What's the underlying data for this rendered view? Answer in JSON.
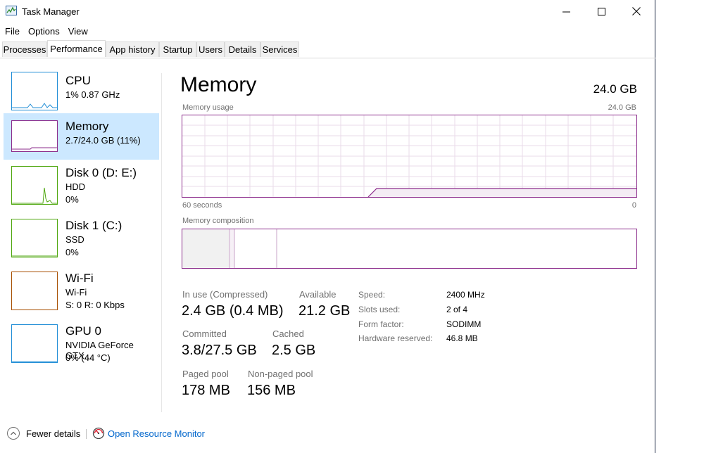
{
  "window": {
    "title": "Task Manager",
    "icon": "task-manager-icon",
    "controls": [
      "minimize-icon",
      "maximize-icon",
      "close-icon"
    ]
  },
  "menu": [
    "File",
    "Options",
    "View"
  ],
  "tabs": [
    {
      "label": "Processes",
      "active": false
    },
    {
      "label": "Performance",
      "active": true
    },
    {
      "label": "App history",
      "active": false
    },
    {
      "label": "Startup",
      "active": false
    },
    {
      "label": "Users",
      "active": false
    },
    {
      "label": "Details",
      "active": false
    },
    {
      "label": "Services",
      "active": false
    }
  ],
  "sidebar": {
    "items": [
      {
        "name": "CPU",
        "line1": "1% 0.87 GHz",
        "line2": "",
        "color": "#1f8dd6",
        "selected": false
      },
      {
        "name": "Memory",
        "line1": "2.7/24.0 GB (11%)",
        "line2": "",
        "color": "#8b2b8b",
        "selected": true
      },
      {
        "name": "Disk 0 (D: E:)",
        "line1": "HDD",
        "line2": "0%",
        "color": "#4da60c",
        "selected": false
      },
      {
        "name": "Disk 1 (C:)",
        "line1": "SSD",
        "line2": "0%",
        "color": "#4da60c",
        "selected": false
      },
      {
        "name": "Wi-Fi",
        "line1": "Wi-Fi",
        "line2": "S: 0 R: 0 Kbps",
        "color": "#a74f01",
        "selected": false
      },
      {
        "name": "GPU 0",
        "line1": "NVIDIA GeForce GTX...",
        "line2": "0% (44 °C)",
        "color": "#1f8dd6",
        "selected": false
      }
    ]
  },
  "main": {
    "title": "Memory",
    "total": "24.0 GB",
    "usage_label": "Memory usage",
    "usage_max": "24.0 GB",
    "time_left": "60 seconds",
    "time_right": "0",
    "composition_label": "Memory composition",
    "graph_color": "#8b2b8b",
    "stats": {
      "in_use_label": "In use (Compressed)",
      "in_use_value": "2.4 GB (0.4 MB)",
      "available_label": "Available",
      "available_value": "21.2 GB",
      "committed_label": "Committed",
      "committed_value": "3.8/27.5 GB",
      "cached_label": "Cached",
      "cached_value": "2.5 GB",
      "paged_label": "Paged pool",
      "paged_value": "178 MB",
      "nonpaged_label": "Non-paged pool",
      "nonpaged_value": "156 MB"
    },
    "specs": [
      {
        "label": "Speed:",
        "value": "2400 MHz"
      },
      {
        "label": "Slots used:",
        "value": "2 of 4"
      },
      {
        "label": "Form factor:",
        "value": "SODIMM"
      },
      {
        "label": "Hardware reserved:",
        "value": "46.8 MB"
      }
    ]
  },
  "footer": {
    "fewer_details": "Fewer details",
    "resource_monitor": "Open Resource Monitor",
    "link_color": "#0066cc"
  }
}
